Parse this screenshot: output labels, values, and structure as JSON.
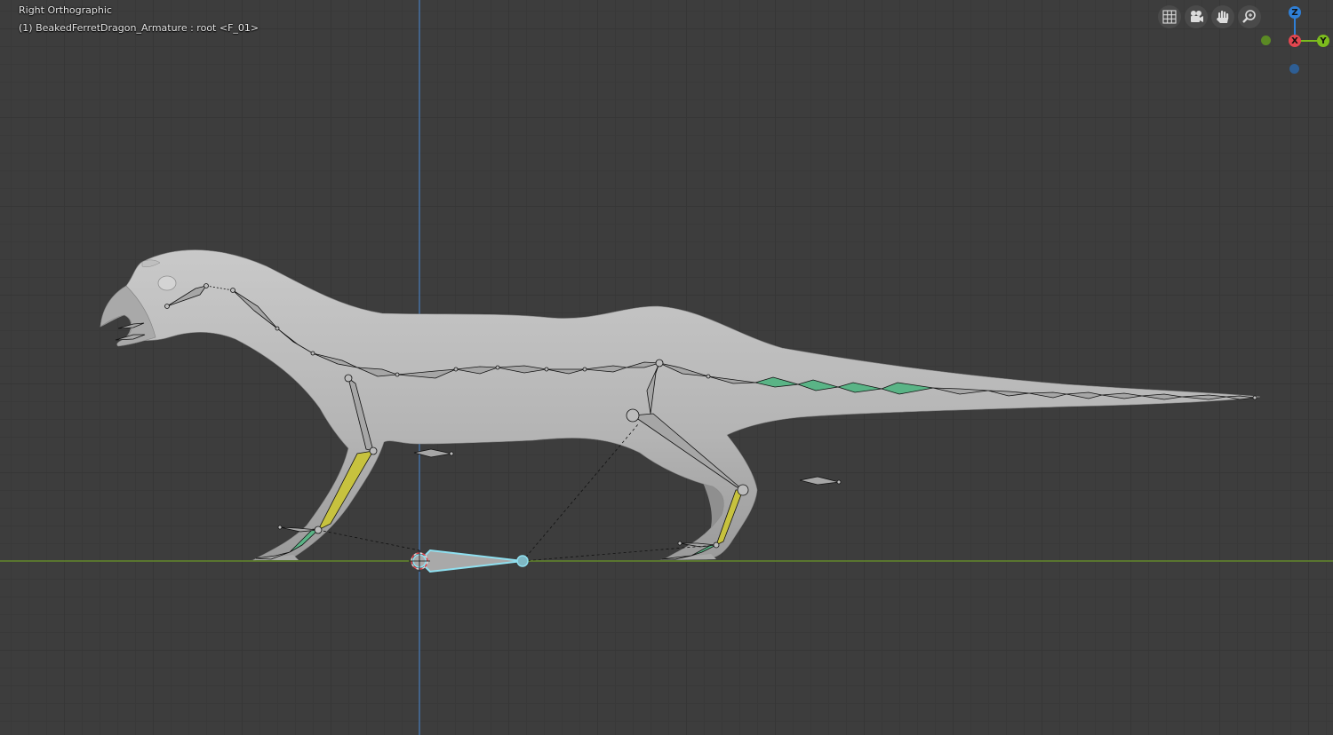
{
  "viewport": {
    "view_name": "Right Orthographic",
    "object_info": "(1) BeakedFerretDragon_Armature : root <F_01>"
  },
  "nav_buttons": [
    {
      "name": "toggle-grid-view-icon"
    },
    {
      "name": "camera-view-icon"
    },
    {
      "name": "pan-hand-icon"
    },
    {
      "name": "zoom-magnifier-icon"
    }
  ],
  "gizmo": {
    "z_label": "Z",
    "x_label": "X",
    "y_label": "Y",
    "colors": {
      "z": "#2f7fd6",
      "x": "#e2464f",
      "y": "#7cbc1d",
      "neg_y": "#5b8a24",
      "neg_z": "#2e5e94"
    }
  },
  "colors": {
    "background": "#3d3d3d",
    "ground_axis": "#6d9a2a",
    "vertical_axis": "#4a7fbf",
    "mesh": "#b7b7b7",
    "bone": "#a9a9a9",
    "bone_green": "#5ab486",
    "bone_yellow": "#c7c23e",
    "active_bone": "#8fe0f0"
  }
}
